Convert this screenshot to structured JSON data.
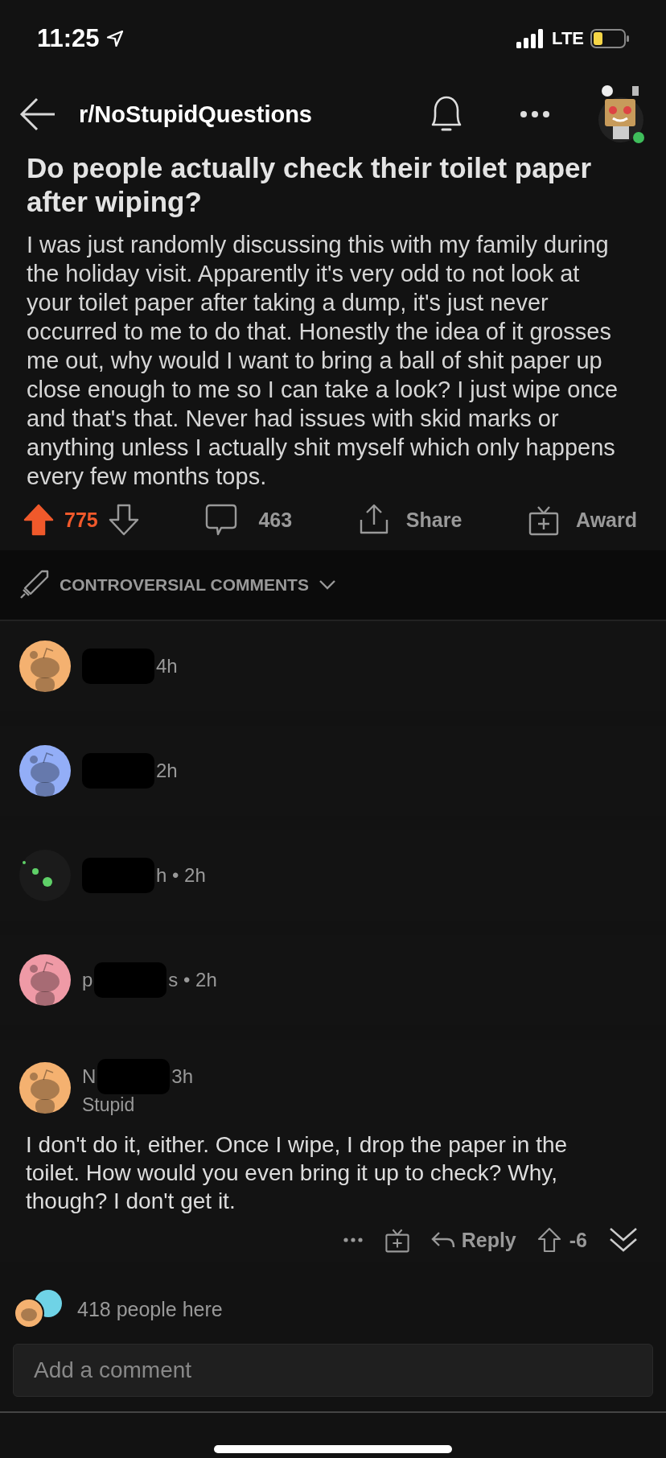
{
  "status_bar": {
    "time": "11:25",
    "network": "LTE"
  },
  "nav": {
    "subreddit": "r/NoStupidQuestions"
  },
  "post": {
    "title": "Do people actually check their toilet paper after wiping?",
    "body": "I was just randomly discussing this with my family during the holiday visit. Apparently it's very odd to not look at your toilet paper after taking a dump, it's just never occurred to me to do that. Honestly the idea of it grosses me out, why would I want to bring a ball of shit paper up close enough to me so I can take a look? I just wipe once and that's that. Never had issues with skid marks or anything unless I actually shit myself which only happens every few months tops.",
    "score": "775",
    "upvoted": true,
    "comments": "463",
    "share": "Share",
    "award": "Award"
  },
  "sort": {
    "label": "CONTROVERSIAL COMMENTS"
  },
  "comments": [
    {
      "kind": "snoo",
      "color": "#f4b170",
      "meta": "4h",
      "collapsed": true
    },
    {
      "kind": "snoo",
      "color": "#93aef7",
      "meta": "2h",
      "collapsed": true
    },
    {
      "kind": "dots",
      "color": "#5fd068",
      "meta": "h • 2h",
      "collapsed": true
    },
    {
      "kind": "snoo",
      "color": "#ef9aa6",
      "name_prefix": "p",
      "meta": "s • 2h",
      "collapsed": true
    },
    {
      "kind": "snoo",
      "color": "#f4b170",
      "name_prefix": "N",
      "meta": "3h",
      "collapsed": false,
      "flair": "Stupid",
      "body": "I don't do it, either. Once I wipe, I drop the paper in the toilet. How would you even bring it up to check? Why, though? I don't get it.",
      "reply": "Reply",
      "score": "-6"
    }
  ],
  "presence": {
    "text": "418 people here"
  },
  "composer": {
    "placeholder": "Add a comment"
  }
}
